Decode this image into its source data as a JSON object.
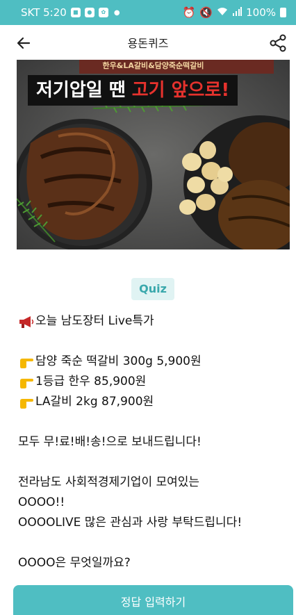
{
  "status_bar": {
    "carrier_time": "SKT 5:20",
    "battery": "100%"
  },
  "app_bar": {
    "title": "용돈퀴즈"
  },
  "banner": {
    "top_text": "한우&LA갈비&담양죽순떡갈비",
    "headline_plain": "저기압일 땐 ",
    "headline_accent": "고기 앞으로!"
  },
  "quiz_badge": "Quiz",
  "content": {
    "line1": "오늘 남도장터 Live특가",
    "item1": "담양 죽순 떡갈비 300g 5,900원",
    "item2": "1등급 한우 85,900원",
    "item3": "LA갈비 2kg 87,900원",
    "line2": "모두 무!료!배!송!으로 보내드립니다!",
    "line3": "전라남도 사회적경제기업이 모여있는",
    "line4": "OOOO!!",
    "line5": "OOOOLIVE 많은 관심과 사랑 부탁드립니다!",
    "question": "OOOO은 무엇일까요?"
  },
  "submit_button": "정답 입력하기",
  "colors": {
    "accent": "#4fbec2",
    "badge_bg": "#e0f3f3",
    "badge_text": "#3aa8ac",
    "headline_red": "#e5322d"
  }
}
